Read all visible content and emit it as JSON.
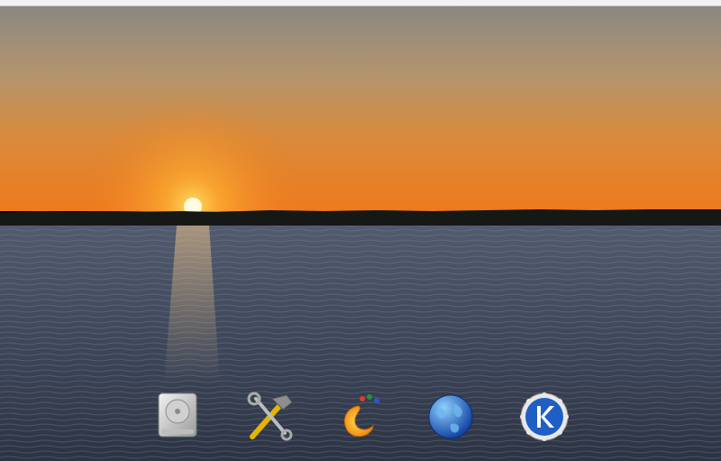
{
  "desktop": {
    "wallpaper": "sunset-over-lake",
    "colors": {
      "sky_top": "#8c8682",
      "sky_mid": "#c98a45",
      "horizon_glow": "#f07a1e",
      "sun": "#fffbe0",
      "treeline": "#161816",
      "water": "#3f4a5e"
    }
  },
  "dock": {
    "items": [
      {
        "icon": "hard-drive-icon"
      },
      {
        "icon": "tools-icon"
      },
      {
        "icon": "app-flame-icon"
      },
      {
        "icon": "globe-icon"
      },
      {
        "icon": "kde-icon"
      }
    ]
  }
}
